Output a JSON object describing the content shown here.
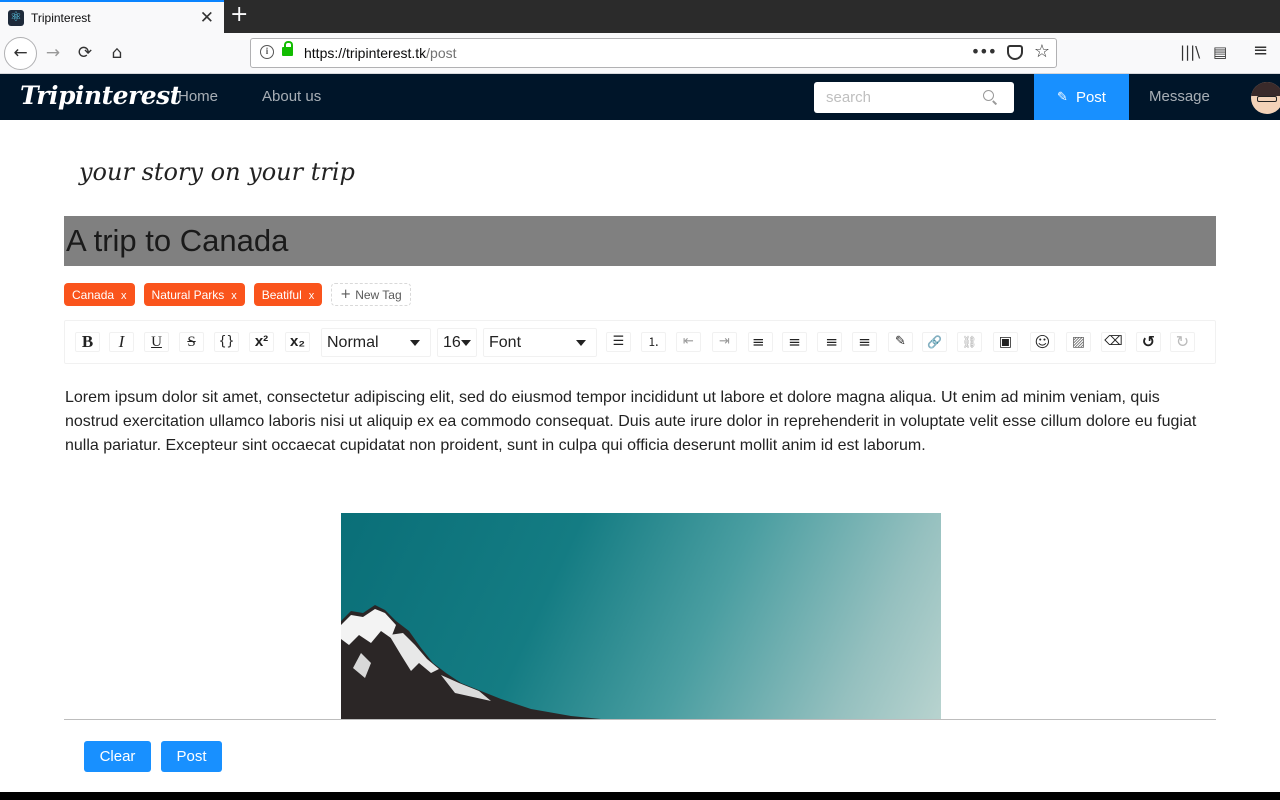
{
  "browser": {
    "tab_title": "Tripinterest",
    "tab_favicon": "react-logo-icon",
    "close_glyph": "✕",
    "new_tab_glyph": "+",
    "url_domain": "https://tripinterest.tk",
    "url_path": "/post",
    "icons": [
      "back-icon",
      "forward-icon",
      "reload-icon",
      "home-icon",
      "info-icon",
      "lock-icon",
      "more-icon",
      "pocket-icon",
      "bookmark-star-icon",
      "library-icon",
      "sidebar-icon",
      "menu-icon"
    ],
    "glyphs": {
      "back": "←",
      "forward": "→",
      "reload": "⟳",
      "home": "⌂",
      "info": "i",
      "more": "•••",
      "star": "☆",
      "library": "|||\\",
      "sidebar": "▤",
      "menu": "≡"
    }
  },
  "header": {
    "logo": "Tripinterest",
    "nav": {
      "home": "Home",
      "about": "About us",
      "message": "Message"
    },
    "search_placeholder": "search",
    "post_label": "Post",
    "post_icon_glyph": "✎",
    "colors": {
      "bg": "#001529",
      "accent": "#1890ff"
    }
  },
  "page": {
    "subtitle": "your story on your trip",
    "title_value": "A trip to Canada",
    "tags": [
      {
        "label": "Canada",
        "close": "x"
      },
      {
        "label": "Natural Parks",
        "close": "x"
      },
      {
        "label": "Beatiful",
        "close": "x"
      }
    ],
    "new_tag": {
      "plus": "+",
      "label": "New Tag"
    },
    "tag_color": "#fa541c",
    "toolbar": {
      "bold": "B",
      "italic": "I",
      "underline": "U",
      "strikethrough": "S",
      "code": "{}",
      "superscript": "x²",
      "subscript": "x₂",
      "block_type": "Normal",
      "font_size": "16",
      "font_family": "Font",
      "icons": [
        "unordered-list-icon",
        "ordered-list-icon",
        "outdent-icon",
        "indent-icon",
        "align-left-icon",
        "align-center-icon",
        "align-right-icon",
        "justify-icon",
        "color-picker-icon",
        "link-icon",
        "unlink-icon",
        "embed-icon",
        "emoji-icon",
        "image-icon",
        "eraser-icon",
        "undo-icon",
        "redo-icon"
      ],
      "glyphs": {
        "ul": "☰",
        "ol": "⒈",
        "outdent": "⇤",
        "indent": "⇥",
        "left": "≡",
        "center": "≡",
        "right": "≡",
        "justify": "≡",
        "color": "✎",
        "link": "🔗",
        "unlink": "⛓",
        "embed": "▣",
        "emoji": "☺",
        "image": "▨",
        "eraser": "⌫",
        "undo": "↺",
        "redo": "↻"
      }
    },
    "body": "Lorem ipsum dolor sit amet, consectetur adipiscing elit, sed do eiusmod tempor incididunt ut labore et dolore magna aliqua. Ut enim ad minim veniam, quis nostrud exercitation ullamco laboris nisi ut aliquip ex ea commodo consequat. Duis aute irure dolor in reprehenderit in voluptate velit esse cillum dolore eu fugiat nulla pariatur. Excepteur sint occaecat cupidatat non proident, sunt in culpa qui officia deserunt mollit anim id est laborum.",
    "actions": {
      "clear": "Clear",
      "post": "Post"
    }
  }
}
